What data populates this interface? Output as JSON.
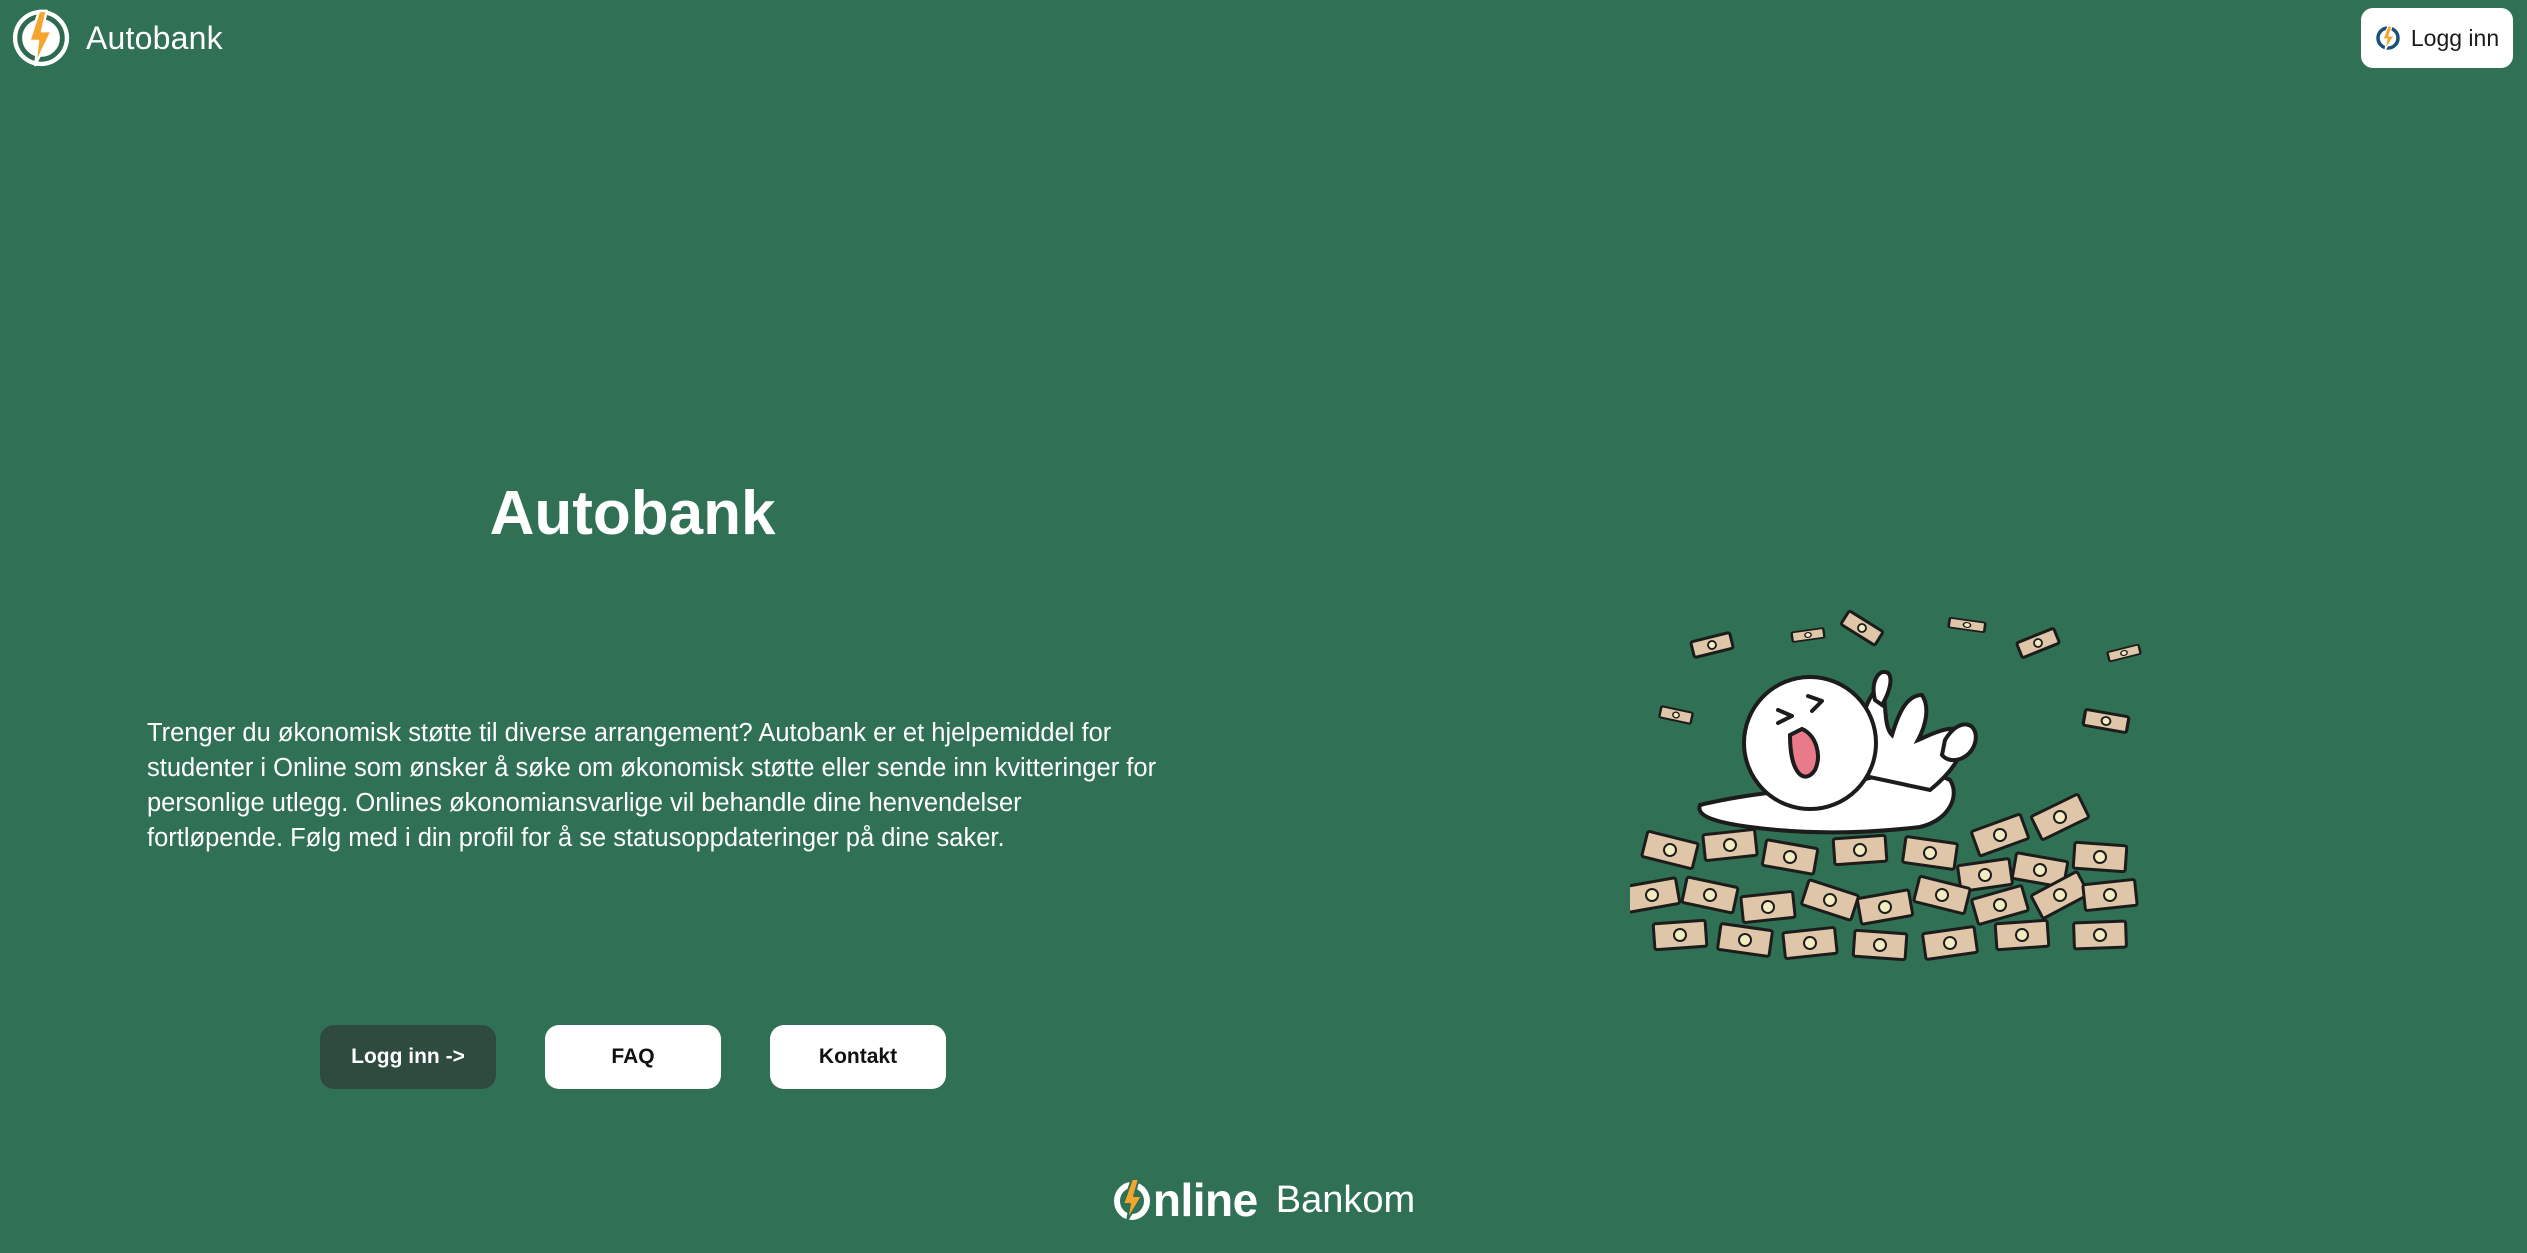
{
  "header": {
    "brand_name": "Autobank",
    "brand_logo_icon": "lightning-logo-icon",
    "login_label": "Logg inn",
    "login_icon": "online-logo-icon"
  },
  "hero": {
    "title": "Autobank",
    "description": "Trenger du økonomisk støtte til diverse arrangement? Autobank er et hjelpemiddel for studenter i Online som ønsker å søke om økonomisk støtte eller sende inn kvitteringer for personlige utlegg. Onlines økonomiansvarlige vil behandle dine henvendelser fortløpende. Følg med i din profil for å se statusoppdateringer på dine saker."
  },
  "buttons": {
    "login": "Logg inn ->",
    "faq": "FAQ",
    "contact": "Kontakt"
  },
  "illustration": {
    "icon": "money-pile-character-icon"
  },
  "footer": {
    "online_text": "nline",
    "bankom_text": "Bankom"
  },
  "colors": {
    "background": "#307155",
    "primary_button": "#2f4a3e",
    "accent_orange": "#f4a52e",
    "logo_blue": "#1a4f7a"
  }
}
